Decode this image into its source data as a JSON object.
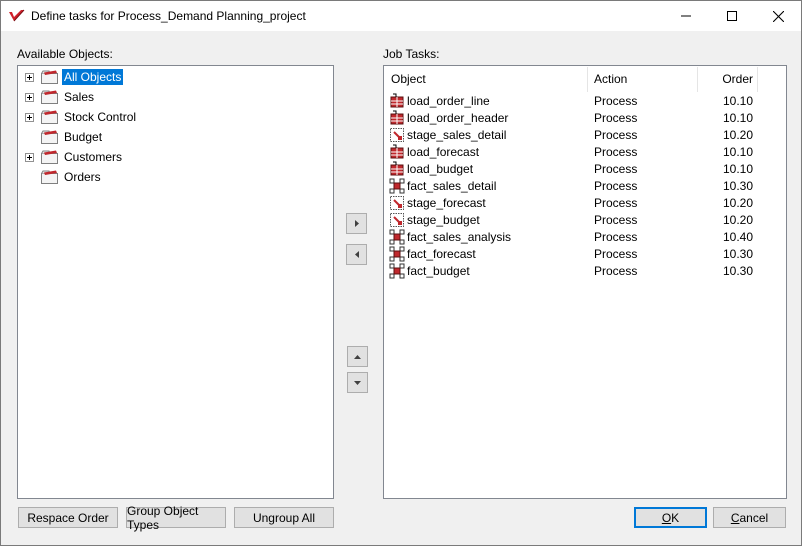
{
  "window": {
    "title": "Define tasks for Process_Demand Planning_project"
  },
  "available": {
    "label": "Available Objects:",
    "items": [
      {
        "label": "All Objects",
        "expandable": true,
        "selected": true
      },
      {
        "label": "Sales",
        "expandable": true,
        "selected": false
      },
      {
        "label": "Stock Control",
        "expandable": true,
        "selected": false
      },
      {
        "label": "Budget",
        "expandable": false,
        "selected": false
      },
      {
        "label": "Customers",
        "expandable": true,
        "selected": false
      },
      {
        "label": "Orders",
        "expandable": false,
        "selected": false
      }
    ]
  },
  "job_tasks": {
    "label": "Job Tasks:",
    "columns": {
      "object": "Object",
      "action": "Action",
      "order": "Order"
    },
    "rows": [
      {
        "object": "load_order_line",
        "action": "Process",
        "order": "10.10",
        "icon": "load-table-icon"
      },
      {
        "object": "load_order_header",
        "action": "Process",
        "order": "10.10",
        "icon": "load-table-icon"
      },
      {
        "object": "stage_sales_detail",
        "action": "Process",
        "order": "10.20",
        "icon": "stage-table-icon"
      },
      {
        "object": "load_forecast",
        "action": "Process",
        "order": "10.10",
        "icon": "load-table-icon"
      },
      {
        "object": "load_budget",
        "action": "Process",
        "order": "10.10",
        "icon": "load-table-icon"
      },
      {
        "object": "fact_sales_detail",
        "action": "Process",
        "order": "10.30",
        "icon": "fact-table-icon"
      },
      {
        "object": "stage_forecast",
        "action": "Process",
        "order": "10.20",
        "icon": "stage-table-icon"
      },
      {
        "object": "stage_budget",
        "action": "Process",
        "order": "10.20",
        "icon": "stage-table-icon"
      },
      {
        "object": "fact_sales_analysis",
        "action": "Process",
        "order": "10.40",
        "icon": "fact-table-icon"
      },
      {
        "object": "fact_forecast",
        "action": "Process",
        "order": "10.30",
        "icon": "fact-table-icon"
      },
      {
        "object": "fact_budget",
        "action": "Process",
        "order": "10.30",
        "icon": "fact-table-icon"
      }
    ]
  },
  "buttons": {
    "respace_order": "Respace Order",
    "group_object_types": "Group Object Types",
    "ungroup_all": "Ungroup All",
    "ok": "OK",
    "cancel": "Cancel"
  },
  "colors": {
    "selection": "#0078d7",
    "load_icon": "#c0282d",
    "fact_icon": "#c0282d"
  }
}
